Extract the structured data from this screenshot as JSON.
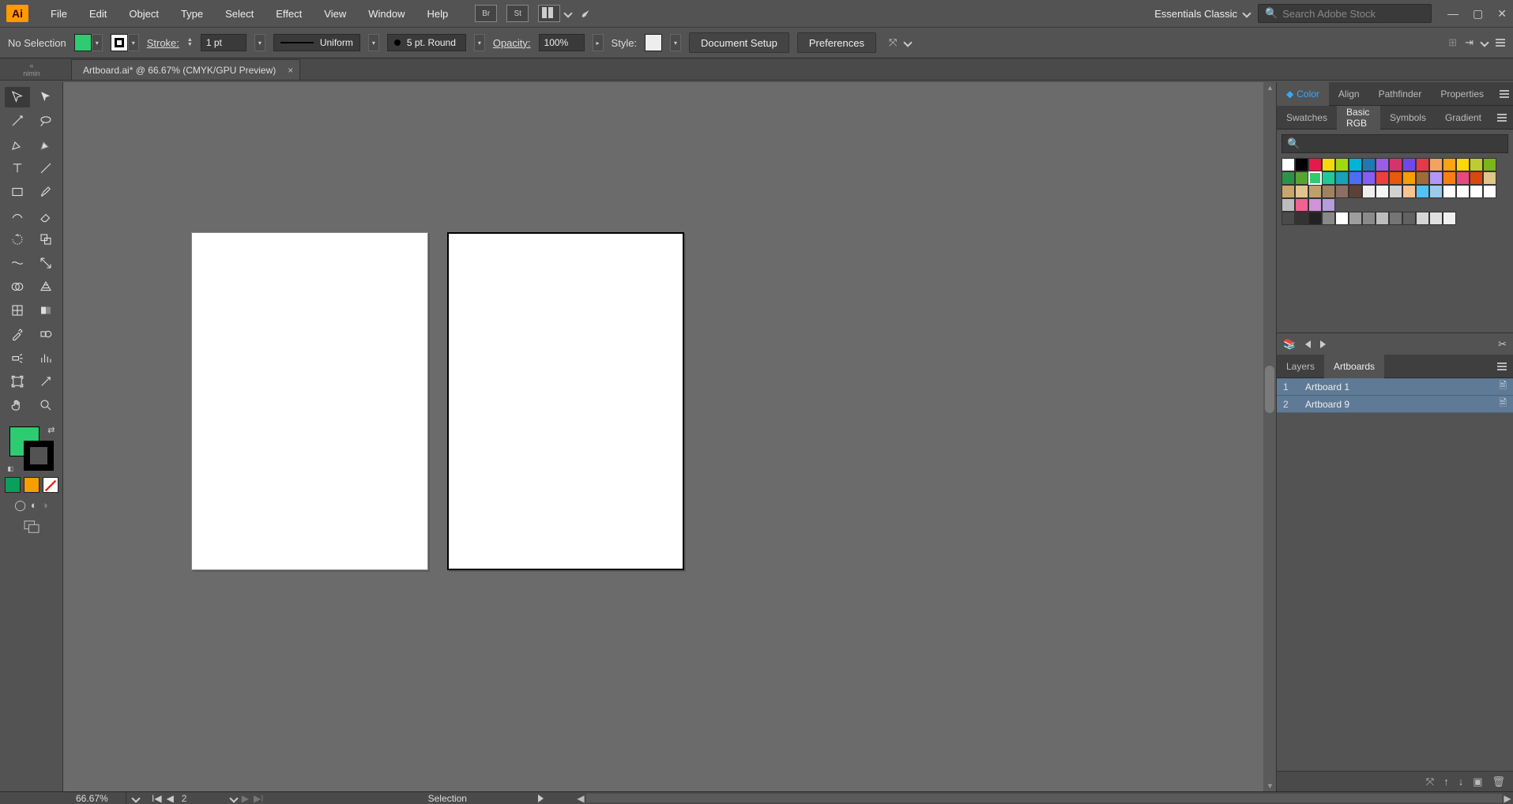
{
  "app": {
    "logo_text": "Ai"
  },
  "menubar": {
    "items": [
      "File",
      "Edit",
      "Object",
      "Type",
      "Select",
      "Effect",
      "View",
      "Window",
      "Help"
    ],
    "aux1": "Br",
    "aux2": "St",
    "workspace": "Essentials Classic",
    "search_placeholder": "Search Adobe Stock"
  },
  "controlbar": {
    "selection_label": "No Selection",
    "fill_color": "#2ecc71",
    "stroke_color": "#000000",
    "stroke_label": "Stroke:",
    "stroke_weight": "1 pt",
    "profile_label": "Uniform",
    "brush_label": "5 pt. Round",
    "opacity_label": "Opacity:",
    "opacity_value": "100%",
    "style_label": "Style:",
    "btn_doc_setup": "Document Setup",
    "btn_prefs": "Preferences"
  },
  "document": {
    "tab_title": "Artboard.ai* @ 66.67% (CMYK/GPU Preview)",
    "collapse_text": "nimin"
  },
  "panels": {
    "group1_tabs": [
      "Color",
      "Align",
      "Pathfinder",
      "Properties"
    ],
    "group1_active": 0,
    "group2_tabs": [
      "Swatches",
      "Basic RGB",
      "Symbols",
      "Gradient"
    ],
    "group2_active": 1,
    "swatch_rows": [
      [
        "#ffffff",
        "#000000",
        "#e6194b",
        "#f5d90a",
        "#a0d911",
        "#00b4d8",
        "#1f77b4",
        "#9b5de5",
        "#d6336c",
        "#7048e8",
        "#e63946",
        "#f4a261",
        "#fca311",
        "#ffd60a",
        "#c0ca33",
        "#7cb518"
      ],
      [
        "#2b9348",
        "#55a630",
        "#2ecc71",
        "#20c997",
        "#17a2b8",
        "#4c6ef5",
        "#845ef7",
        "#f03e3e",
        "#e8590c",
        "#f59f00",
        "#9e6b3a",
        "#b197fc",
        "#fd7e14",
        "#e64980",
        "#d9480f",
        "#dec787"
      ],
      [
        "#c9a66b",
        "#e0c58f",
        "#bfa06b",
        "#a08160",
        "#8d6e63",
        "#5d4037",
        "#eeeeee",
        "#f5f5f5",
        "#d1d1d1",
        "#f8c291",
        "#4fc3f7",
        "#99ccee",
        "#ffffff",
        "#ffffff",
        "#ffffff",
        "#ffffff"
      ],
      [
        "#bdbdbd",
        "#f06292",
        "#ce93d8",
        "#b39ddb"
      ],
      [
        "#4a4a4a",
        "#333333",
        "#222222",
        "#888888",
        "#ffffff",
        "#9e9e9e",
        "#8a8a8a",
        "#bdbdbd",
        "#757575",
        "#616161",
        "#d6d6d6",
        "#e0e0e0",
        "#f0f0f0"
      ]
    ],
    "swatch_selected": {
      "row": 1,
      "col": 2
    },
    "group3_tabs": [
      "Layers",
      "Artboards"
    ],
    "group3_active": 1,
    "artboards": [
      {
        "index": "1",
        "name": "Artboard 1"
      },
      {
        "index": "2",
        "name": "Artboard 9"
      }
    ]
  },
  "statusbar": {
    "zoom": "66.67%",
    "artboard_nav_value": "2",
    "tool_label": "Selection"
  },
  "toolbox": {
    "fill_color": "#2ecc71",
    "quick_colors": [
      "#0a9f5b",
      "#f59f00"
    ]
  }
}
